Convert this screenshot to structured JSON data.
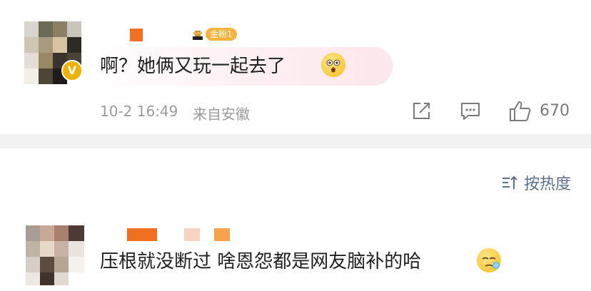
{
  "comments": [
    {
      "badge": "金粉1",
      "verified_mark": "V",
      "text": "啊？她俩又玩一起去了",
      "time": "10-2 16:49",
      "location": "来自安徽",
      "likes": "670",
      "emoji_icon": "shocked-face-emoji"
    },
    {
      "text": "压根就没断过 啥恩怨都是网友脑补的哈",
      "emoji_icon": "sleepy-face-emoji"
    }
  ],
  "sort": {
    "label": "按热度",
    "icon": "sort-icon"
  },
  "colors": {
    "badge": "#f5b33b",
    "name_redaction": "#f07020",
    "verified": "#f0b100",
    "meta": "#9a9a9a",
    "sort": "#5a6f8f",
    "divider": "#f2f2f2"
  }
}
